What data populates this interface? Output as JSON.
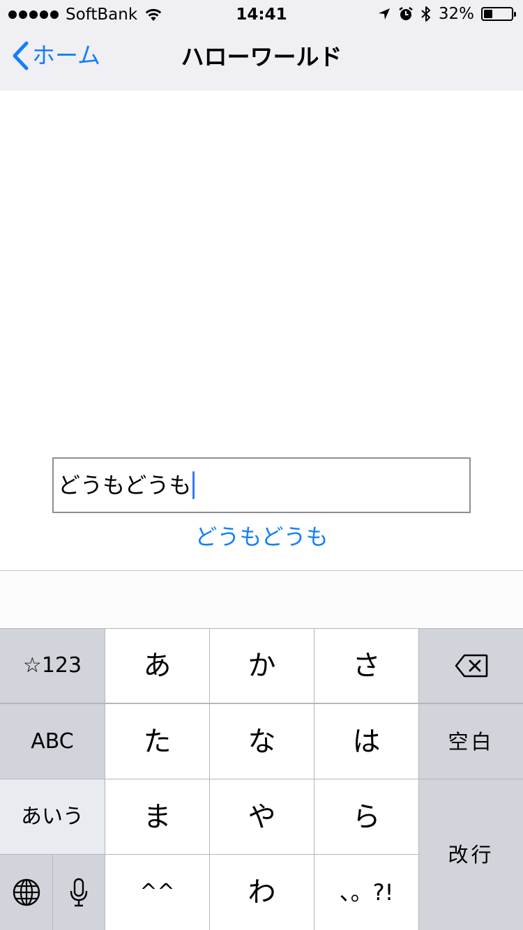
{
  "status_bar": {
    "carrier": "SoftBank",
    "time": "14:41",
    "battery_percent": "32%",
    "battery_level": 0.32,
    "icons": [
      "signal-dots-icon",
      "wifi-icon",
      "location-arrow-icon",
      "alarm-clock-icon",
      "bluetooth-icon",
      "battery-icon"
    ]
  },
  "nav": {
    "back_label": "ホーム",
    "title": "ハローワールド"
  },
  "content": {
    "text_field_value": "どうもどうも",
    "mirror_label": "どうもどうも"
  },
  "keyboard": {
    "keys": {
      "symbols": "☆123",
      "a": "あ",
      "ka": "か",
      "sa": "さ",
      "abc": "ABC",
      "ta": "た",
      "na": "な",
      "ha": "は",
      "space": "空白",
      "aiu": "あいう",
      "ma": "ま",
      "ya": "や",
      "ra": "ら",
      "return": "改行",
      "caret_faces": "^^",
      "wa": "わ",
      "punct": "、。?!"
    },
    "icons": [
      "delete-icon",
      "globe-icon",
      "microphone-icon"
    ]
  },
  "colors": {
    "accent": "#157efb",
    "nav_background": "#efeff4",
    "key_white": "#ffffff",
    "key_gray": "#d1d4da",
    "key_divider": "#b4b6bb",
    "caret": "#3478f6"
  }
}
